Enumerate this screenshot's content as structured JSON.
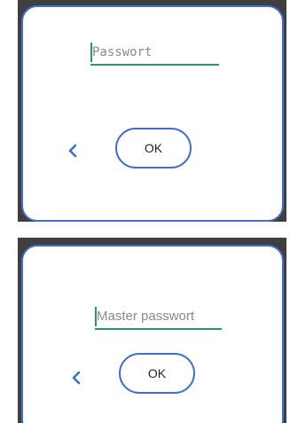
{
  "colors": {
    "accent": "#3f6fd0",
    "field_underline": "#2f8f7a",
    "frame": "#3f3f3f",
    "placeholder": "#8a8a8a"
  },
  "dialogs": [
    {
      "field": {
        "placeholder": "Passwort"
      },
      "back_icon": "chevron-left-icon",
      "ok_label": "OK"
    },
    {
      "field": {
        "placeholder": "Master passwort"
      },
      "back_icon": "chevron-left-icon",
      "ok_label": "OK"
    }
  ]
}
